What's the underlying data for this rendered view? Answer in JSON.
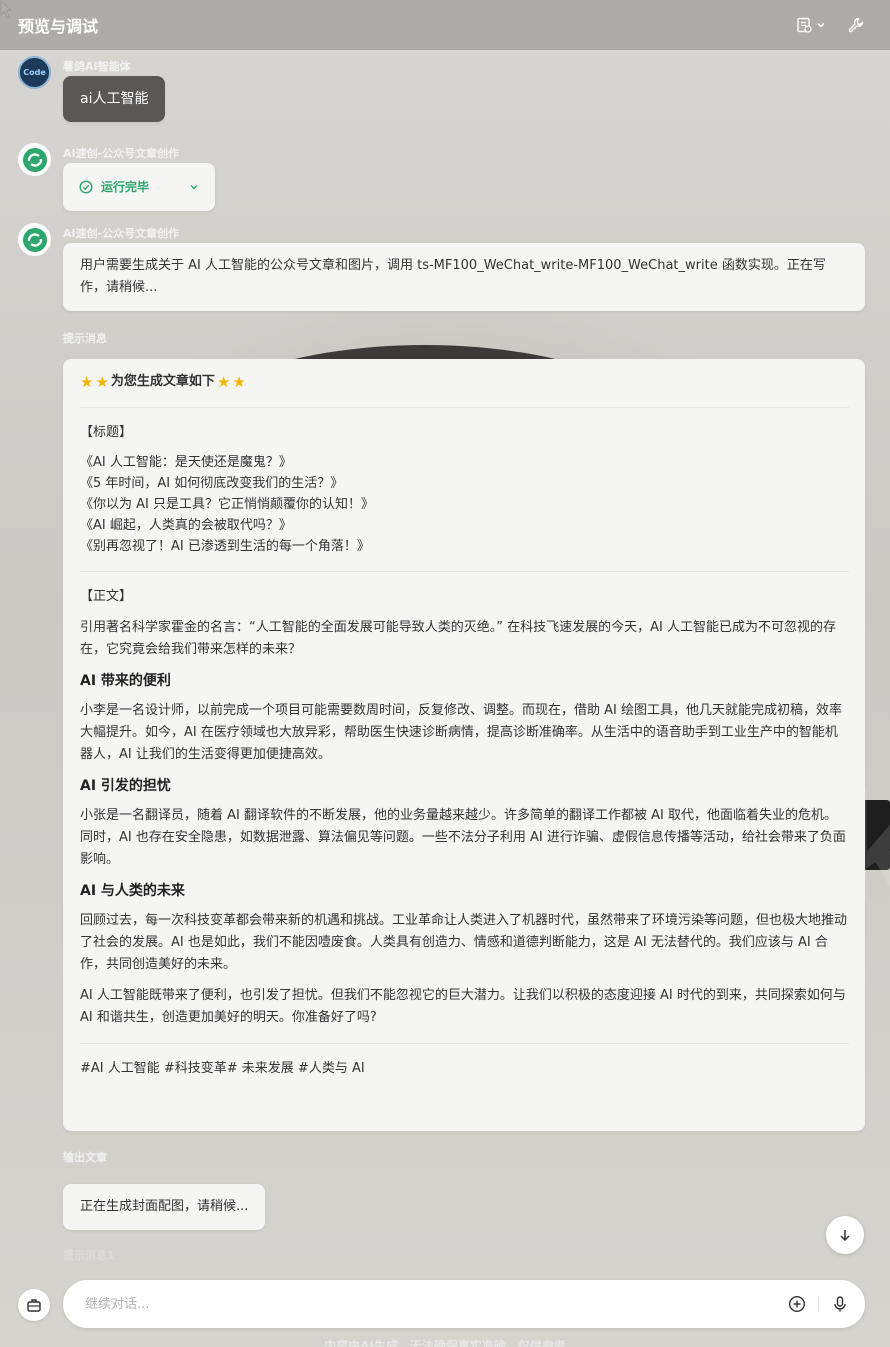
{
  "header": {
    "title": "预览与调试"
  },
  "messages": {
    "user": {
      "sender": "薯鸽AI智能体",
      "avatar_text": "Code",
      "text": "ai人工智能"
    },
    "bot1": {
      "sender": "AI速创-公众号文章创作",
      "status": "运行完毕"
    },
    "bot2": {
      "sender": "AI速创-公众号文章创作",
      "text": "用户需要生成关于 AI 人工智能的公众号文章和图片，调用 ts-MF100_WeChat_write-MF100_WeChat_write 函数实现。正在写作，请稍候..."
    }
  },
  "hint_label": "提示消息",
  "article": {
    "heading": "为您生成文章如下",
    "title_tag": "【标题】",
    "titles": [
      "《AI 人工智能：是天使还是魔鬼？》",
      "《5 年时间，AI 如何彻底改变我们的生活？》",
      "《你以为 AI 只是工具？它正悄悄颠覆你的认知！》",
      "《AI 崛起，人类真的会被取代吗？》",
      "《别再忽视了！AI 已渗透到生活的每一个角落！》"
    ],
    "body_tag": "【正文】",
    "intro": "引用著名科学家霍金的名言：“人工智能的全面发展可能导致人类的灭绝。” 在科技飞速发展的今天，AI 人工智能已成为不可忽视的存在，它究竟会给我们带来怎样的未来？",
    "sections": [
      {
        "heading": "AI 带来的便利",
        "text": "小李是一名设计师，以前完成一个项目可能需要数周时间，反复修改、调整。而现在，借助 AI 绘图工具，他几天就能完成初稿，效率大幅提升。如今，AI 在医疗领域也大放异彩，帮助医生快速诊断病情，提高诊断准确率。从生活中的语音助手到工业生产中的智能机器人，AI 让我们的生活变得更加便捷高效。"
      },
      {
        "heading": "AI 引发的担忧",
        "text": "小张是一名翻译员，随着 AI 翻译软件的不断发展，他的业务量越来越少。许多简单的翻译工作都被 AI 取代，他面临着失业的危机。同时，AI 也存在安全隐患，如数据泄露、算法偏见等问题。一些不法分子利用 AI 进行诈骗、虚假信息传播等活动，给社会带来了负面影响。"
      },
      {
        "heading": "AI 与人类的未来",
        "text": "回顾过去，每一次科技变革都会带来新的机遇和挑战。工业革命让人类进入了机器时代，虽然带来了环境污染等问题，但也极大地推动了社会的发展。AI 也是如此，我们不能因噎废食。人类具有创造力、情感和道德判断能力，这是 AI 无法替代的。我们应该与 AI 合作，共同创造美好的未来。"
      }
    ],
    "conclusion": "AI 人工智能既带来了便利，也引发了担忧。但我们不能忽视它的巨大潜力。让我们以积极的态度迎接 AI 时代的到来，共同探索如何与 AI 和谐共生，创造更加美好的明天。你准备好了吗?",
    "tags": "#AI 人工智能 #科技变革# 未来发展 #人类与 AI"
  },
  "output_label": "输出文章",
  "generating_text": "正在生成封面配图，请稍候...",
  "hint_label_2": "提示消息1",
  "input": {
    "placeholder": "继续对话..."
  },
  "footer_note": "内容由AI生成，无法确保真实准确，仅供参考",
  "colors": {
    "status_green": "#2ba76b",
    "star": "#f2b400",
    "user_bubble": "#5a5856"
  }
}
